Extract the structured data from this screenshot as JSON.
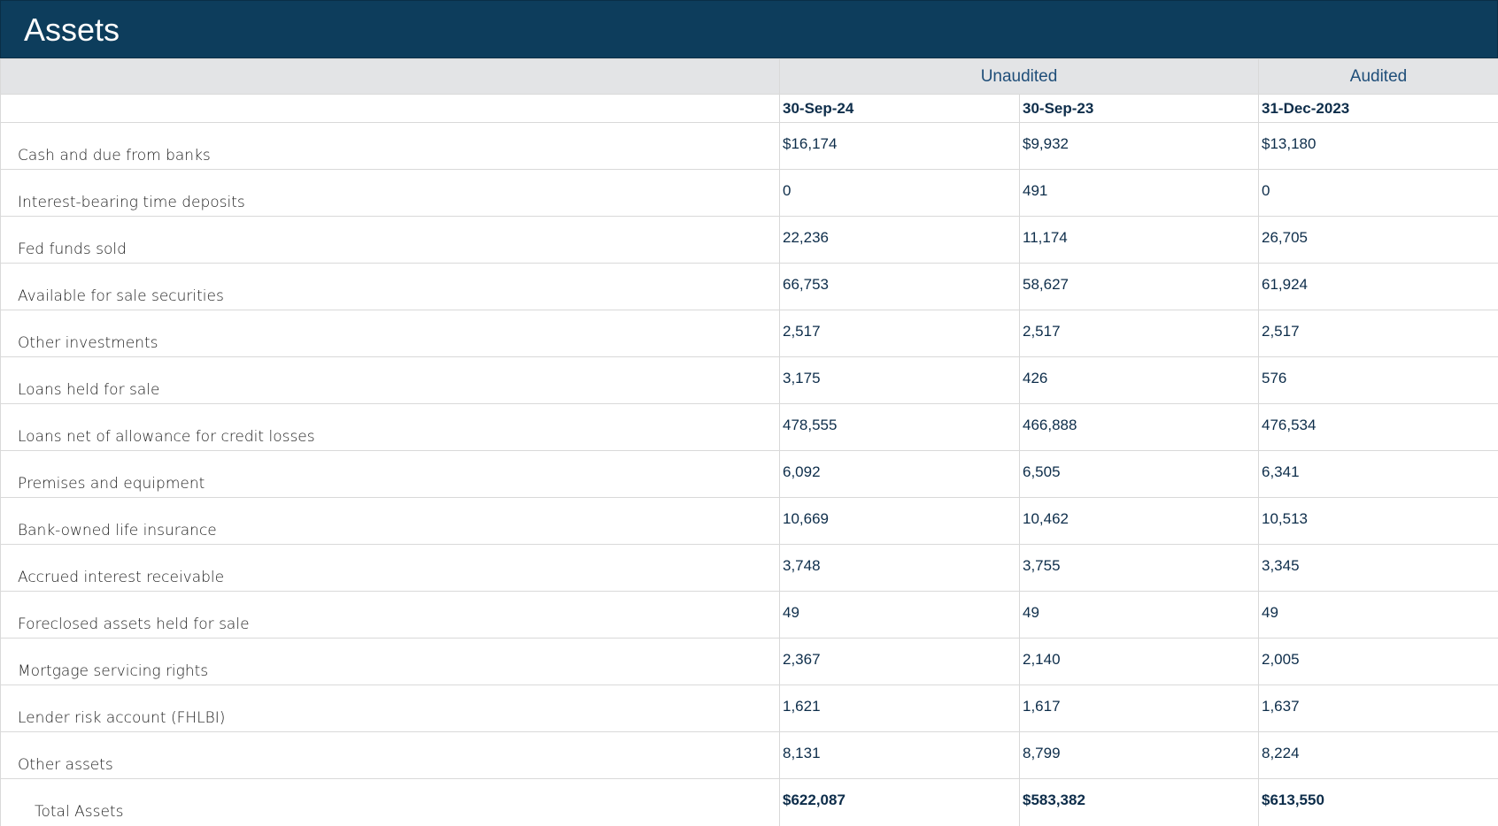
{
  "header": {
    "title": "Assets"
  },
  "groups": {
    "unaudited": "Unaudited",
    "audited": "Audited"
  },
  "dates": [
    "30-Sep-24",
    "30-Sep-23",
    "31-Dec-2023"
  ],
  "rows": [
    {
      "label": "Cash and due from banks",
      "values": [
        "$16,174",
        "$9,932",
        "$13,180"
      ]
    },
    {
      "label": "Interest-bearing time deposits",
      "values": [
        "0",
        "491",
        "0"
      ]
    },
    {
      "label": "Fed funds sold",
      "values": [
        "22,236",
        "11,174",
        "26,705"
      ]
    },
    {
      "label": "Available for sale securities",
      "values": [
        "66,753",
        "58,627",
        "61,924"
      ]
    },
    {
      "label": "Other investments",
      "values": [
        "2,517",
        "2,517",
        "2,517"
      ]
    },
    {
      "label": "Loans held for sale",
      "values": [
        "3,175",
        "426",
        "576"
      ]
    },
    {
      "label": "Loans net of allowance for credit losses",
      "values": [
        "478,555",
        "466,888",
        "476,534"
      ]
    },
    {
      "label": "Premises and equipment",
      "values": [
        "6,092",
        "6,505",
        "6,341"
      ]
    },
    {
      "label": "Bank-owned life insurance",
      "values": [
        "10,669",
        "10,462",
        "10,513"
      ]
    },
    {
      "label": "Accrued interest receivable",
      "values": [
        "3,748",
        "3,755",
        "3,345"
      ]
    },
    {
      "label": "Foreclosed assets held for sale",
      "values": [
        "49",
        "49",
        "49"
      ]
    },
    {
      "label": "Mortgage servicing rights",
      "values": [
        "2,367",
        "2,140",
        "2,005"
      ]
    },
    {
      "label": "Lender risk account (FHLBI)",
      "values": [
        "1,621",
        "1,617",
        "1,637"
      ]
    },
    {
      "label": "Other assets",
      "values": [
        "8,131",
        "8,799",
        "8,224"
      ]
    }
  ],
  "total": {
    "label": "Total Assets",
    "values": [
      "$622,087",
      "$583,382",
      "$613,550"
    ]
  }
}
